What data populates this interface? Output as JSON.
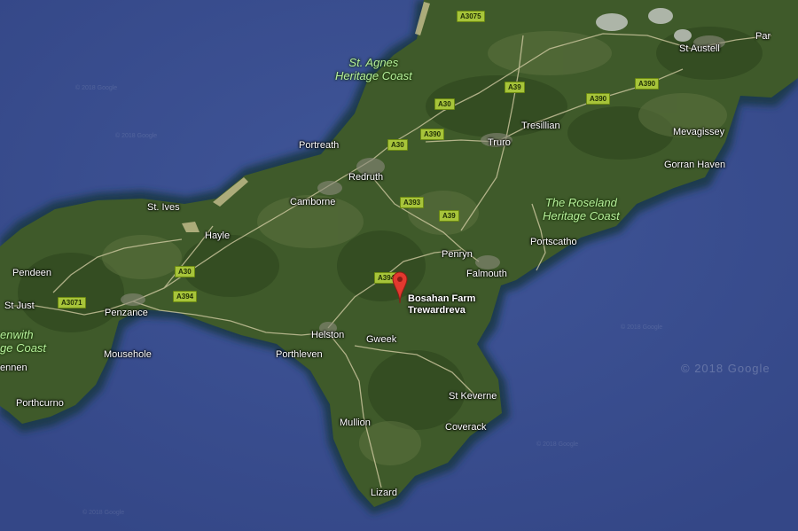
{
  "map": {
    "type": "satellite",
    "region": "Cornwall",
    "colors": {
      "sea": "#3a4f93",
      "land": "#3f5a2a",
      "coast": "#17313f",
      "road": "#d8d0a8",
      "pin": "#e3392f"
    }
  },
  "places": {
    "st_agnes": {
      "line1": "St. Agnes",
      "line2": "Heritage Coast"
    },
    "roseland": {
      "line1": "The Roseland",
      "line2": "Heritage Coast"
    },
    "penwith": {
      "line1": "enwith",
      "line2": "ge Coast"
    },
    "st_austell": "St Austell",
    "par": "Par",
    "mevagissey": "Mevagissey",
    "gorran_haven": "Gorran Haven",
    "tresillian": "Tresillian",
    "truro": "Truro",
    "portreath": "Portreath",
    "redruth": "Redruth",
    "camborne": "Camborne",
    "st_ives": "St. Ives",
    "hayle": "Hayle",
    "penryn": "Penryn",
    "falmouth": "Falmouth",
    "portscatho": "Portscatho",
    "pendeen": "Pendeen",
    "st_just": "St Just",
    "penzance": "Penzance",
    "nennen": "ennen",
    "mousehole": "Mousehole",
    "porthcurno": "Porthcurno",
    "helston": "Helston",
    "gweek": "Gweek",
    "porthleven": "Porthleven",
    "st_keverne": "St Keverne",
    "coverack": "Coverack",
    "mullion": "Mullion",
    "lizard": "Lizard"
  },
  "roads": {
    "a3075": "A3075",
    "a39_north": "A39",
    "a390_east": "A390",
    "a30_north": "A30",
    "a390_mid": "A390",
    "a30_redruth": "A30",
    "a393": "A393",
    "a39_penryn": "A39",
    "a394_helston": "A394",
    "a30_hayle": "A30",
    "a394_penzance": "A394",
    "a3071": "A3071",
    "a390_top": "A390"
  },
  "pin": {
    "icon": "map-pin-icon",
    "line1": "Bosahan Farm",
    "line2": "Trewardreva"
  },
  "watermarks": {
    "small": "© 2018 Google",
    "large": "© 2018 Google"
  }
}
